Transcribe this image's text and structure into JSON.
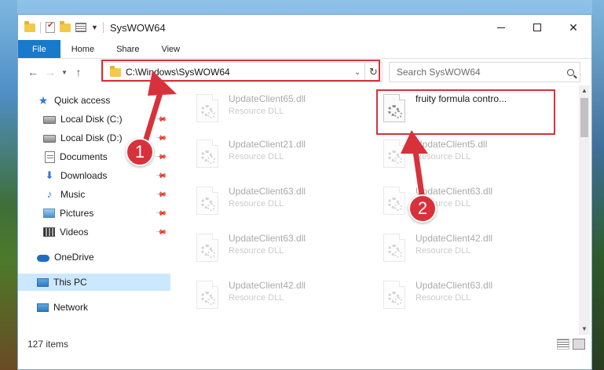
{
  "window": {
    "title": "SysWOW64",
    "controls": {
      "minimize": "minimize",
      "maximize": "maximize",
      "close": "✕"
    }
  },
  "ribbon": {
    "tabs": [
      "File",
      "Home",
      "Share",
      "View"
    ]
  },
  "navigation": {
    "back_icon": "back-arrow-icon",
    "forward_icon": "forward-arrow-icon",
    "recent_icon": "chevron-down-icon",
    "up_icon": "up-arrow-icon"
  },
  "address": {
    "path": "C:\\Windows\\SysWOW64",
    "refresh_icon": "refresh-icon"
  },
  "search": {
    "placeholder": "Search SysWOW64"
  },
  "sidebar": {
    "items": [
      {
        "label": "Quick access",
        "icon": "star-icon",
        "pinned": false
      },
      {
        "label": "Local Disk (C:)",
        "icon": "disk-icon",
        "pinned": true
      },
      {
        "label": "Local Disk (D:)",
        "icon": "disk-icon",
        "pinned": true
      },
      {
        "label": "Documents",
        "icon": "documents-icon",
        "pinned": true
      },
      {
        "label": "Downloads",
        "icon": "download-icon",
        "pinned": true
      },
      {
        "label": "Music",
        "icon": "music-icon",
        "pinned": true
      },
      {
        "label": "Pictures",
        "icon": "pictures-icon",
        "pinned": true
      },
      {
        "label": "Videos",
        "icon": "videos-icon",
        "pinned": true
      },
      {
        "label": "OneDrive",
        "icon": "cloud-icon",
        "pinned": false
      },
      {
        "label": "This PC",
        "icon": "computer-icon",
        "pinned": false,
        "selected": true
      },
      {
        "label": "Network",
        "icon": "network-icon",
        "pinned": false
      }
    ]
  },
  "files": [
    {
      "name": "UpdateClient65.dll",
      "type": "Resource DLL",
      "highlighted": false
    },
    {
      "name": "fruity formula contro...",
      "type": "",
      "highlighted": true
    },
    {
      "name": "UpdateClient21.dll",
      "type": "Resource DLL",
      "highlighted": false
    },
    {
      "name": "UpdateClient5.dll",
      "type": "Resource DLL",
      "highlighted": false
    },
    {
      "name": "UpdateClient63.dll",
      "type": "Resource DLL",
      "highlighted": false
    },
    {
      "name": "UpdateClient63.dll",
      "type": "Resource DLL",
      "highlighted": false
    },
    {
      "name": "UpdateClient63.dll",
      "type": "Resource DLL",
      "highlighted": false
    },
    {
      "name": "UpdateClient42.dll",
      "type": "Resource DLL",
      "highlighted": false
    },
    {
      "name": "UpdateClient42.dll",
      "type": "Resource DLL",
      "highlighted": false
    },
    {
      "name": "UpdateClient63.dll",
      "type": "Resource DLL",
      "highlighted": false
    }
  ],
  "status": {
    "item_count": "127 items"
  },
  "annotations": {
    "step1": "1",
    "step2": "2",
    "color": "#d7323b"
  }
}
